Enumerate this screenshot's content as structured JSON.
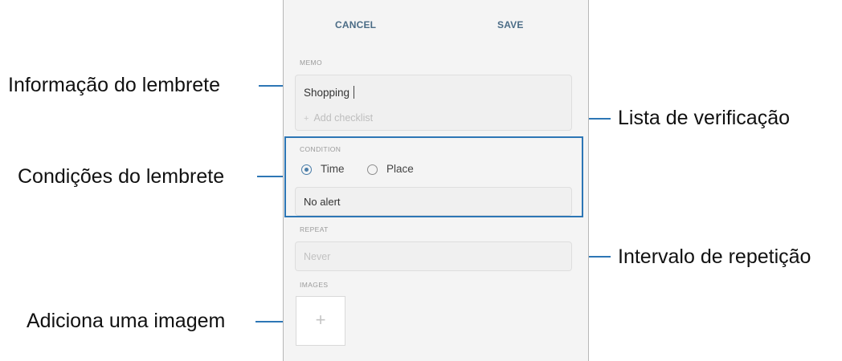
{
  "header": {
    "cancel_label": "CANCEL",
    "save_label": "SAVE"
  },
  "memo": {
    "section_label": "MEMO",
    "text_value": "Shopping",
    "add_checklist_label": "Add checklist",
    "add_checklist_icon": "plus-icon"
  },
  "condition": {
    "section_label": "CONDITION",
    "options": [
      {
        "label": "Time",
        "selected": true
      },
      {
        "label": "Place",
        "selected": false
      }
    ],
    "alert_value": "No alert"
  },
  "repeat": {
    "section_label": "REPEAT",
    "placeholder": "Never"
  },
  "images": {
    "section_label": "IMAGES",
    "add_icon": "plus-icon"
  },
  "callouts": {
    "memo_info": "Informação do lembrete",
    "conditions": "Condições do lembrete",
    "add_image": "Adiciona uma imagem",
    "checklist": "Lista de verificação",
    "repeat_interval": "Intervalo de repetição"
  },
  "colors": {
    "callout_line": "#2d76b5",
    "header_button": "#4b6c86",
    "radio_accent": "#4a7da8"
  }
}
